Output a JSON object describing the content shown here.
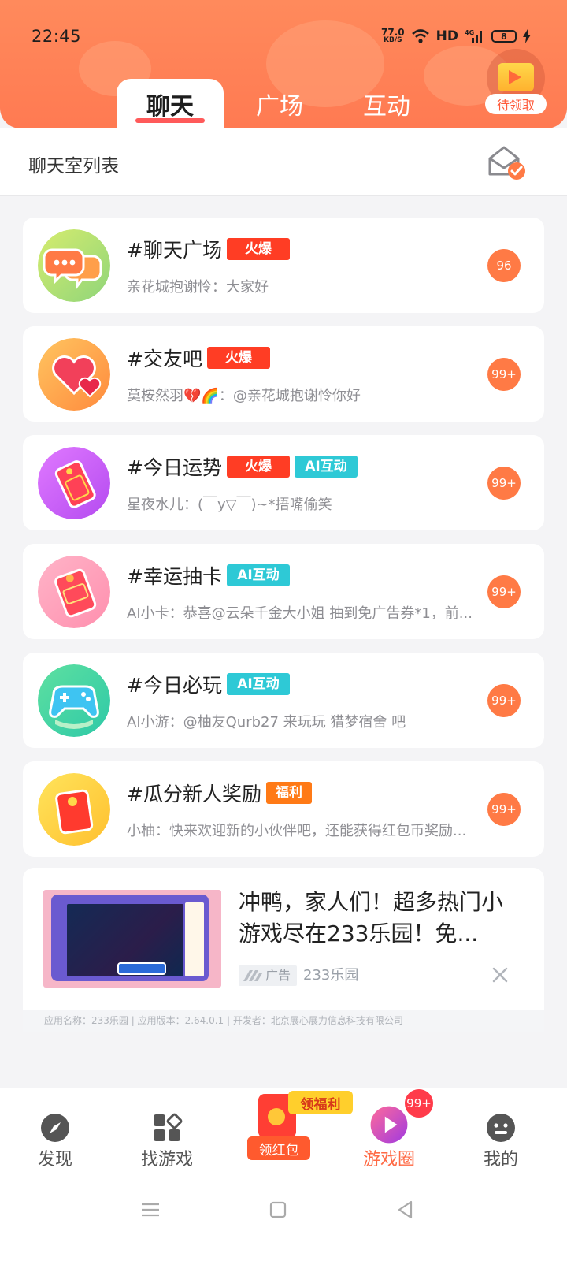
{
  "status_bar": {
    "time": "22:45",
    "net_speed_value": "77.0",
    "net_speed_unit": "KB/S",
    "hd": "HD",
    "battery": "8"
  },
  "header": {
    "tabs": [
      {
        "label": "聊天",
        "active": true
      },
      {
        "label": "广场",
        "active": false
      },
      {
        "label": "互动",
        "active": false
      }
    ],
    "reward_label": "待领取",
    "accent_color": "#ff7a52"
  },
  "subheader": {
    "title": "聊天室列表"
  },
  "rooms": [
    {
      "name": "#聊天广场",
      "tags": [
        "火爆"
      ],
      "message": "亲花城抱谢怜：大家好",
      "badge": "96",
      "avatar_icon": "chat-bubbles-icon"
    },
    {
      "name": "#交友吧",
      "tags": [
        "火爆"
      ],
      "message": "莫桉然羽💔🌈：@亲花城抱谢怜你好",
      "badge": "99+",
      "avatar_icon": "hearts-icon"
    },
    {
      "name": "#今日运势",
      "tags": [
        "火爆",
        "AI互动"
      ],
      "message": "星夜水儿：(￣y▽￣)~*捂嘴偷笑",
      "badge": "99+",
      "avatar_icon": "fortune-tag-icon"
    },
    {
      "name": "#幸运抽卡",
      "tags": [
        "AI互动"
      ],
      "message": "AI小卡：恭喜@云朵千金大小姐 抽到免广告券*1，前...",
      "badge": "99+",
      "avatar_icon": "lucky-card-icon"
    },
    {
      "name": "#今日必玩",
      "tags": [
        "AI互动"
      ],
      "message": "AI小游：@柚友Qurb27 来玩玩 猎梦宿舍 吧",
      "badge": "99+",
      "avatar_icon": "gamepad-icon"
    },
    {
      "name": "#瓜分新人奖励",
      "tags": [
        "福利"
      ],
      "message": "小柚：快来欢迎新的小伙伴吧，还能获得红包币奖励...",
      "badge": "99+",
      "avatar_icon": "red-envelope-icon"
    }
  ],
  "ad": {
    "title": "冲鸭，家人们！超多热门小游戏尽在233乐园！免...",
    "label": "广告",
    "source": "233乐园",
    "info": "应用名称：233乐园 | 应用版本：2.64.0.1 | 开发者：北京展心展力信息科技有限公司"
  },
  "bottom_nav": {
    "items": [
      {
        "label": "发现",
        "icon": "compass-icon",
        "active": false
      },
      {
        "label": "找游戏",
        "icon": "grid-icon",
        "active": false
      },
      {
        "label": "游戏圈",
        "icon": "game-circle-icon",
        "active": true
      },
      {
        "label": "我的",
        "icon": "profile-icon",
        "active": false
      }
    ],
    "redpack_tag": "领福利",
    "redpack_label": "领红包",
    "badge": "99+"
  }
}
